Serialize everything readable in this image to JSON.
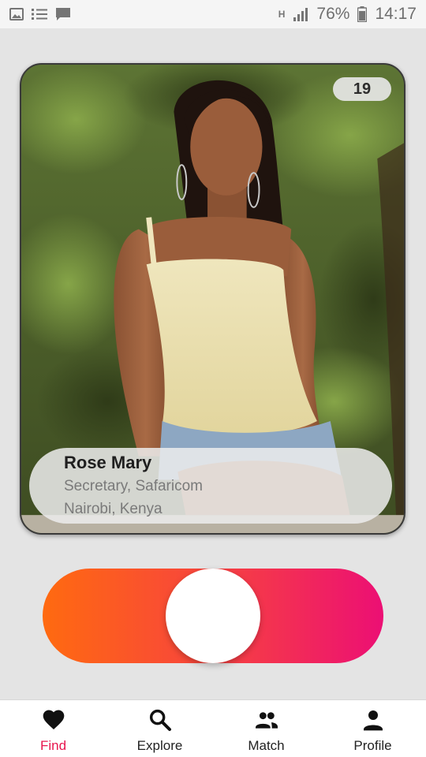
{
  "status_bar": {
    "battery": "76%",
    "time": "14:17",
    "network_label": "H",
    "icons": [
      "image-icon",
      "checklist-icon",
      "chat-icon",
      "network-h-icon",
      "signal-icon",
      "battery-icon"
    ]
  },
  "card": {
    "age": "19",
    "name": "Rose Mary",
    "occupation": "Secretary, Safaricom",
    "location": "Nairobi, Kenya"
  },
  "swipe": {
    "colors": {
      "start": "#ff6a10",
      "end": "#ec0f74"
    },
    "position": 0.5
  },
  "nav": {
    "items": [
      {
        "label": "Find",
        "icon": "heart-icon",
        "active": true
      },
      {
        "label": "Explore",
        "icon": "search-icon",
        "active": false
      },
      {
        "label": "Match",
        "icon": "people-icon",
        "active": false
      },
      {
        "label": "Profile",
        "icon": "person-icon",
        "active": false
      }
    ],
    "active_color": "#e8164f"
  }
}
